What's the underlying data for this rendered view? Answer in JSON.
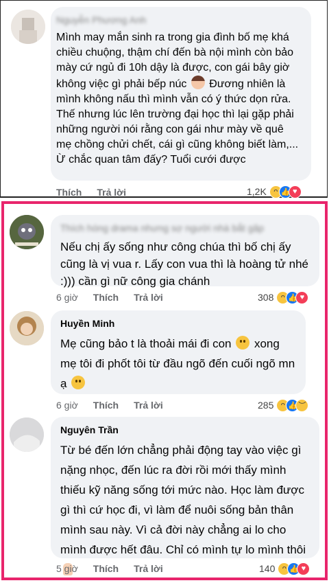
{
  "comments": [
    {
      "author": "Nguyễn Phương Anh",
      "text": "Mình may mắn sinh ra trong gia đình bố mẹ khá chiều chuộng, thậm chí đến bà nội mình còn bảo mày cứ ngủ đi 10h dậy là được, con gái bây giờ không việc gì phải bếp núc",
      "text2": " Đương nhiên là mình không nấu thì mình vẫn có ý thức dọn rửa. Thế nhưng lúc lên trường đại học thì lại gặp phải những người nói rằng con gái như mày về quê mẹ chồng chửi chết, cái gì cũng không biết làm,...",
      "text3": "Ừ chắc          quan tâm đấy? Tuổi     cưới được",
      "time": "",
      "like": "Thích",
      "reply": "Trả lời",
      "reaction_count": "1,2K",
      "reactions": [
        "haha-icon",
        "like-icon",
        "love-icon"
      ]
    },
    {
      "author": "Thích hóng drama nhưng sợ người nhà bắt gặp",
      "text": "Nếu chị ấy sống như công chúa thì bố chị ấy cũng là vị vua r. Lấy con vua thì là hoàng tử nhé :))) cần gì nữ công gia chánh",
      "time": "6 giờ",
      "like": "Thích",
      "reply": "Trả lời",
      "reaction_count": "308",
      "reactions": [
        "haha-icon",
        "like-icon",
        "love-icon"
      ]
    },
    {
      "author": "Huyền Minh",
      "text": "Mẹ cũng bảo t là thoải mái đi con",
      "text2": " xong mẹ tôi đi phốt tôi từ đầu ngõ đến cuối ngõ mn ạ",
      "time": "6 giờ",
      "like": "Thích",
      "reply": "Trả lời",
      "reaction_count": "285",
      "reactions": [
        "haha-icon",
        "like-icon",
        "sad-icon"
      ]
    },
    {
      "author": "Nguyên Trần",
      "text": "Từ bé đến lớn chẳng phải động tay vào việc gì nặng nhọc, đến lúc ra đời rồi mới thấy mình thiếu kỹ năng sống tới mức nào. Học làm được gì thì cứ học đi, vì làm để nuôi sống bản thân mình sau này. Vì cả đời này chẳng ai lo cho mình được hết đâu. Chỉ có mình tự lo mình thôi",
      "time": "5 giờ",
      "like": "Thích",
      "reply": "Trả lời",
      "reaction_count": "140",
      "reactions": [
        "haha-icon",
        "like-icon",
        "love-icon"
      ]
    }
  ],
  "colors": {
    "highlight": "#e8256c",
    "bubble": "#f0f2f5",
    "like": "#1877f2",
    "love": "#f33e58",
    "haha": "#f7c43f"
  }
}
